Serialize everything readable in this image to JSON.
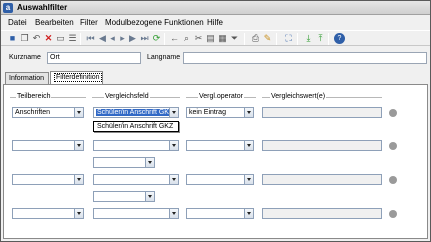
{
  "window": {
    "title": "Auswahlfilter",
    "app_icon_letter": "a"
  },
  "menu": [
    {
      "label": "Datei"
    },
    {
      "label": "Bearbeiten"
    },
    {
      "label": "Filter"
    },
    {
      "label": "Modulbezogene Funktionen"
    },
    {
      "label": "Hilfe"
    }
  ],
  "toolbar": {
    "icons": [
      "save-icon",
      "copy-icon",
      "undo-icon",
      "delete-icon",
      "new-icon",
      "list-icon",
      "first-icon",
      "prev-page-icon",
      "prev-icon",
      "next-icon",
      "next-page-icon",
      "last-icon",
      "refresh-icon",
      "back-arrow-icon",
      "search-icon",
      "cut-icon",
      "paste-icon",
      "filter-icon",
      "print-icon",
      "edit-icon",
      "select-icon",
      "import-icon",
      "export-icon",
      "help-icon"
    ]
  },
  "header": {
    "kurzname_label": "Kurzname",
    "kurzname_value": "Ort",
    "langname_label": "Langname",
    "langname_value": ""
  },
  "tabs": [
    {
      "label": "Information"
    },
    {
      "label": "Filterdefinition"
    }
  ],
  "columns": {
    "teilbereich": "Teilbereich",
    "vergleichsfeld": "Vergleichsfeld",
    "vergloperator": "Vergl.operator",
    "vergleichswert": "Vergleichswert(e)"
  },
  "rows": [
    {
      "teilbereich": "Anschriften",
      "vergleichsfeld": "Schüler/in Anschrift GKZ",
      "operator": "kein Eintrag"
    },
    {
      "teilbereich": "",
      "vergleichsfeld": "",
      "operator": ""
    },
    {
      "teilbereich": "",
      "vergleichsfeld": "",
      "operator": ""
    },
    {
      "teilbereich": "",
      "vergleichsfeld": "",
      "operator": ""
    }
  ],
  "dropdown_open": {
    "option": "Schüler/in Anschrift GKZ"
  },
  "colors": {
    "selection": "#3169c6",
    "title_bg": "#d8d8d8"
  }
}
